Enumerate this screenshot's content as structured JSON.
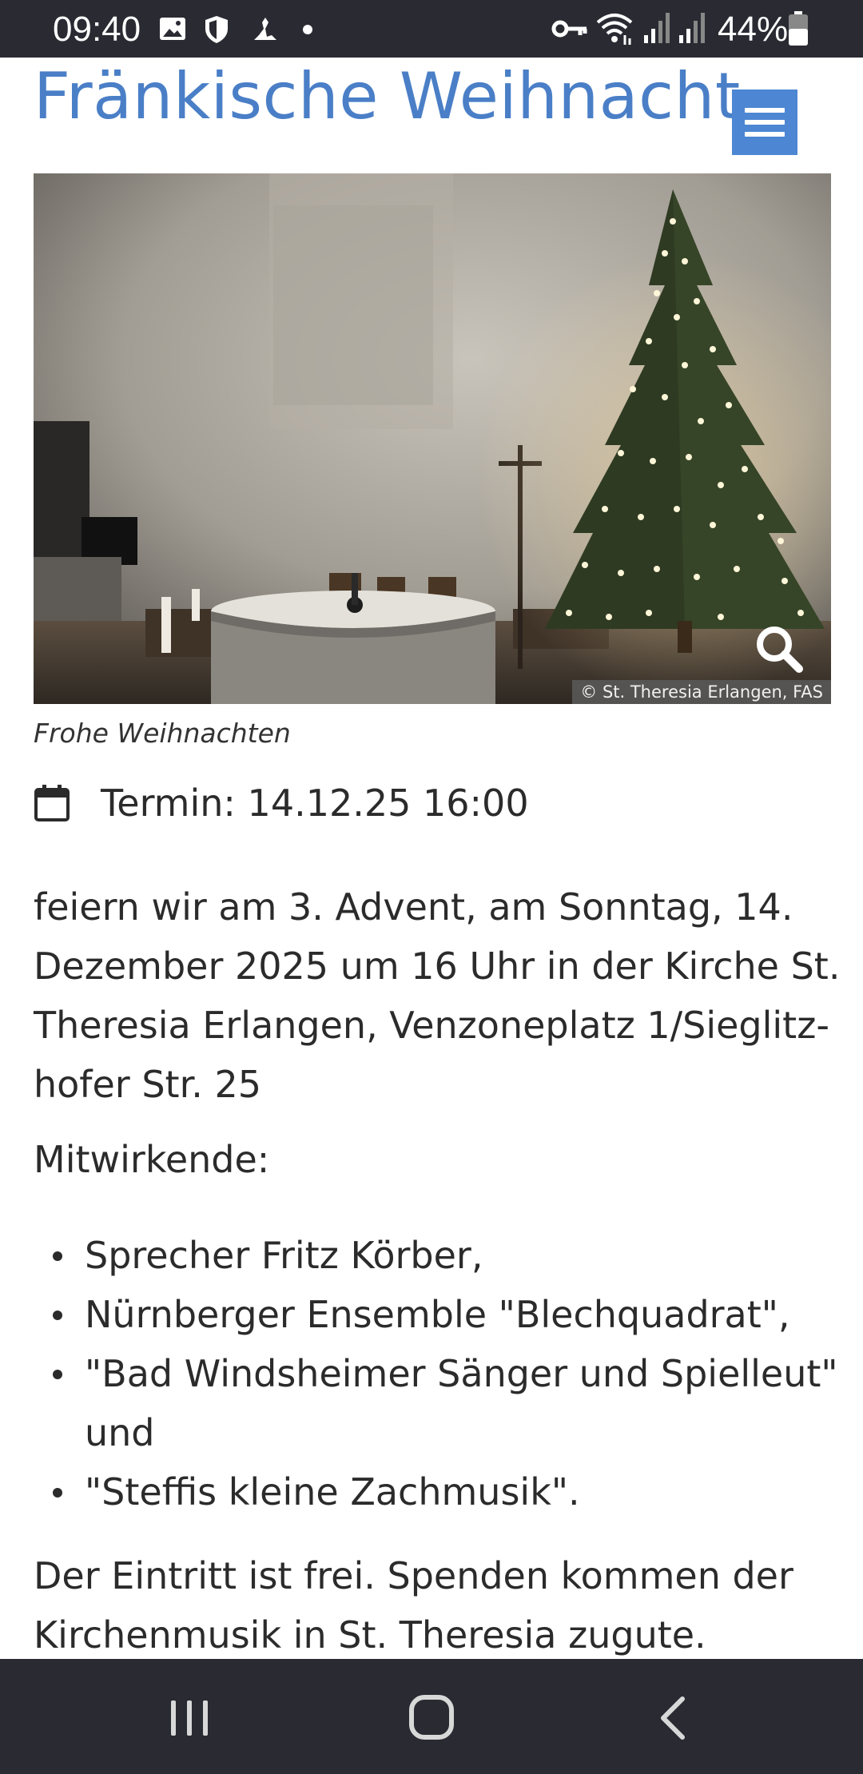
{
  "status_bar": {
    "time": "09:40",
    "battery": "44%",
    "icons": [
      "image-icon",
      "shield-icon",
      "app-icon",
      "dot-icon",
      "key-icon",
      "wifi-icon",
      "signal-icon",
      "signal-icon",
      "battery-icon"
    ]
  },
  "header": {
    "site_title": "Fränkische Weihnacht",
    "menu_icon": "hamburger-icon"
  },
  "article": {
    "image_credit": "© St. Theresia Erlangen, FAS",
    "image_caption": "Frohe Weihnachten",
    "zoom_icon": "search-icon",
    "date_icon": "calendar-icon",
    "date_label": "Termin: 14.12.25 16:00",
    "body_lines": [
      "feiern wir am 3. Advent, am Sonntag, 14.",
      "Dezember 2025 um 16 Uhr in der Kirche St.",
      "Theresia Erlangen, Venzoneplatz 1/Sieglitz-",
      "hofer Str. 25"
    ],
    "participants_heading": "Mitwirkende:",
    "participants": [
      "Sprecher Fritz Körber,",
      "Nürnberger Ensemble \"Blechquadrat\",",
      "\"Bad Windsheimer Sänger und Spielleut\" und",
      "\"Steffis kleine Zachmusik\"."
    ],
    "closing_lines": [
      "Der Eintritt ist frei. Spenden kommen der",
      "Kirchenmusik in St. Theresia zugute."
    ]
  },
  "nav_bar": {
    "icons": [
      "recent-apps-icon",
      "home-icon",
      "back-icon"
    ]
  },
  "colors": {
    "title": "#4a7fc7",
    "menu_button": "#4d86d2",
    "system_bars": "#2a2a33"
  }
}
